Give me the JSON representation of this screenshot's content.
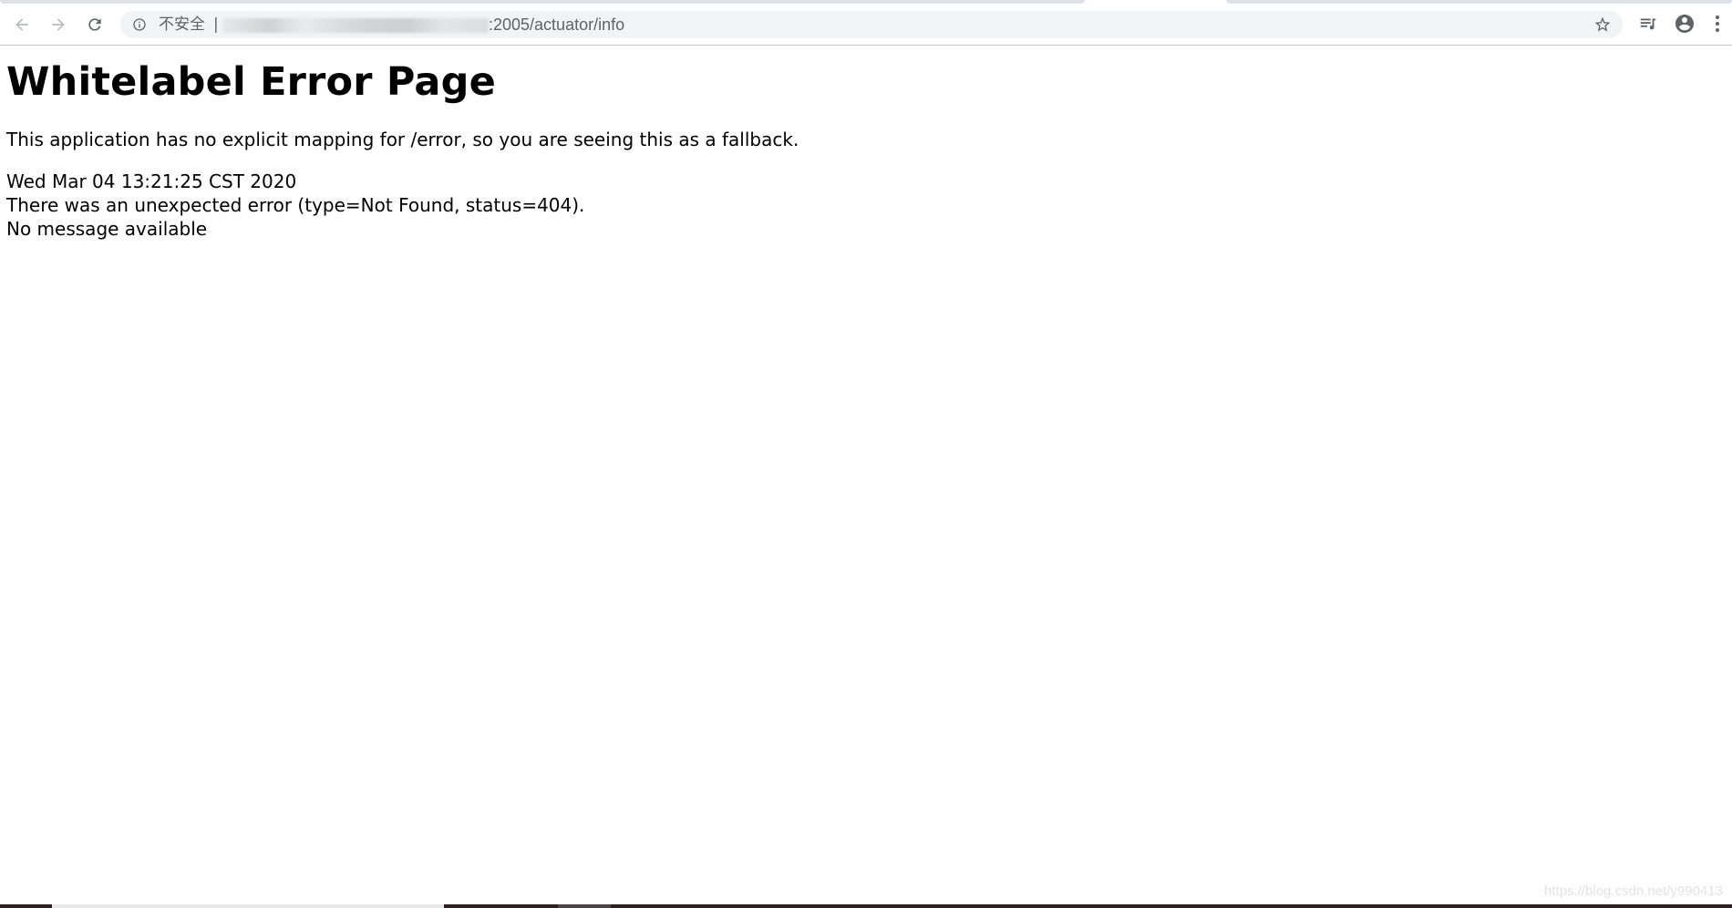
{
  "browser": {
    "security_label": "不安全",
    "separator": "|",
    "url_visible": ":2005/actuator/info"
  },
  "page": {
    "heading": "Whitelabel Error Page",
    "description": "This application has no explicit mapping for /error, so you are seeing this as a fallback.",
    "timestamp": "Wed Mar 04 13:21:25 CST 2020",
    "error_line": "There was an unexpected error (type=Not Found, status=404).",
    "message": "No message available"
  },
  "watermark": "https://blog.csdn.net/y990413",
  "icons": {
    "back": "back-arrow-icon",
    "forward": "forward-arrow-icon",
    "reload": "reload-icon",
    "info": "info-icon",
    "star": "star-icon",
    "media": "media-playlist-icon",
    "profile": "account-icon",
    "menu": "more-vert-icon"
  },
  "colors": {
    "icon_gray": "#5f6368",
    "omnibox_bg": "#f1f3f4",
    "text": "#000000"
  }
}
